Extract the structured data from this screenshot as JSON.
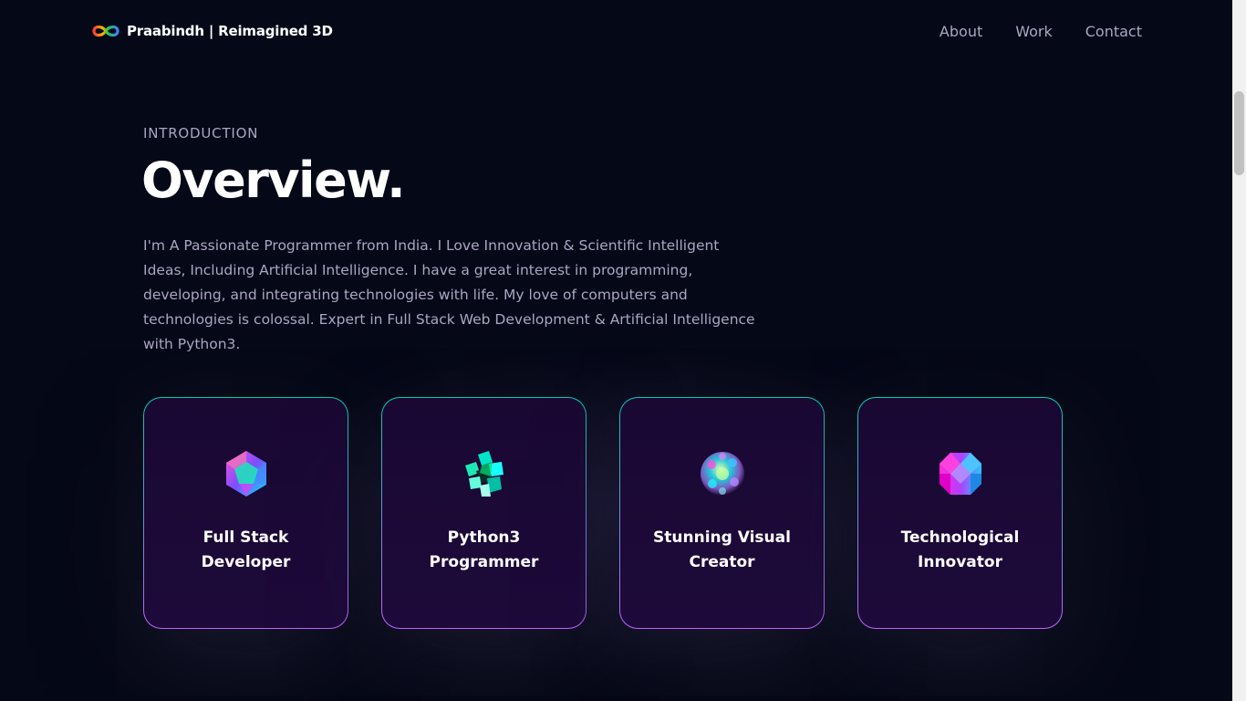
{
  "navbar": {
    "brand": "Praabindh | Reimagined 3D",
    "links": [
      "About",
      "Work",
      "Contact"
    ]
  },
  "overview": {
    "subtitle": "Introduction",
    "title": "Overview.",
    "description": "I'm A Passionate Programmer from India. I Love Innovation & Scientific Intelligent Ideas, Including Artificial Intelligence. I have a great interest in programming, developing, and integrating technologies with life. My love of computers and technologies is colossal. Expert in Full Stack Web Development & Artificial Intelligence with Python3."
  },
  "services": [
    {
      "title": "Full Stack Developer",
      "icon": "gem-icon"
    },
    {
      "title": "Python3 Programmer",
      "icon": "cube-cluster-icon"
    },
    {
      "title": "Stunning Visual Creator",
      "icon": "orb-icon"
    },
    {
      "title": "Technological Innovator",
      "icon": "crystal-icon"
    }
  ],
  "colors": {
    "background": "#050816",
    "secondary_text": "#aaa6c3",
    "card_border_top": "#00cea8",
    "card_border_bottom": "#bf61ff"
  }
}
